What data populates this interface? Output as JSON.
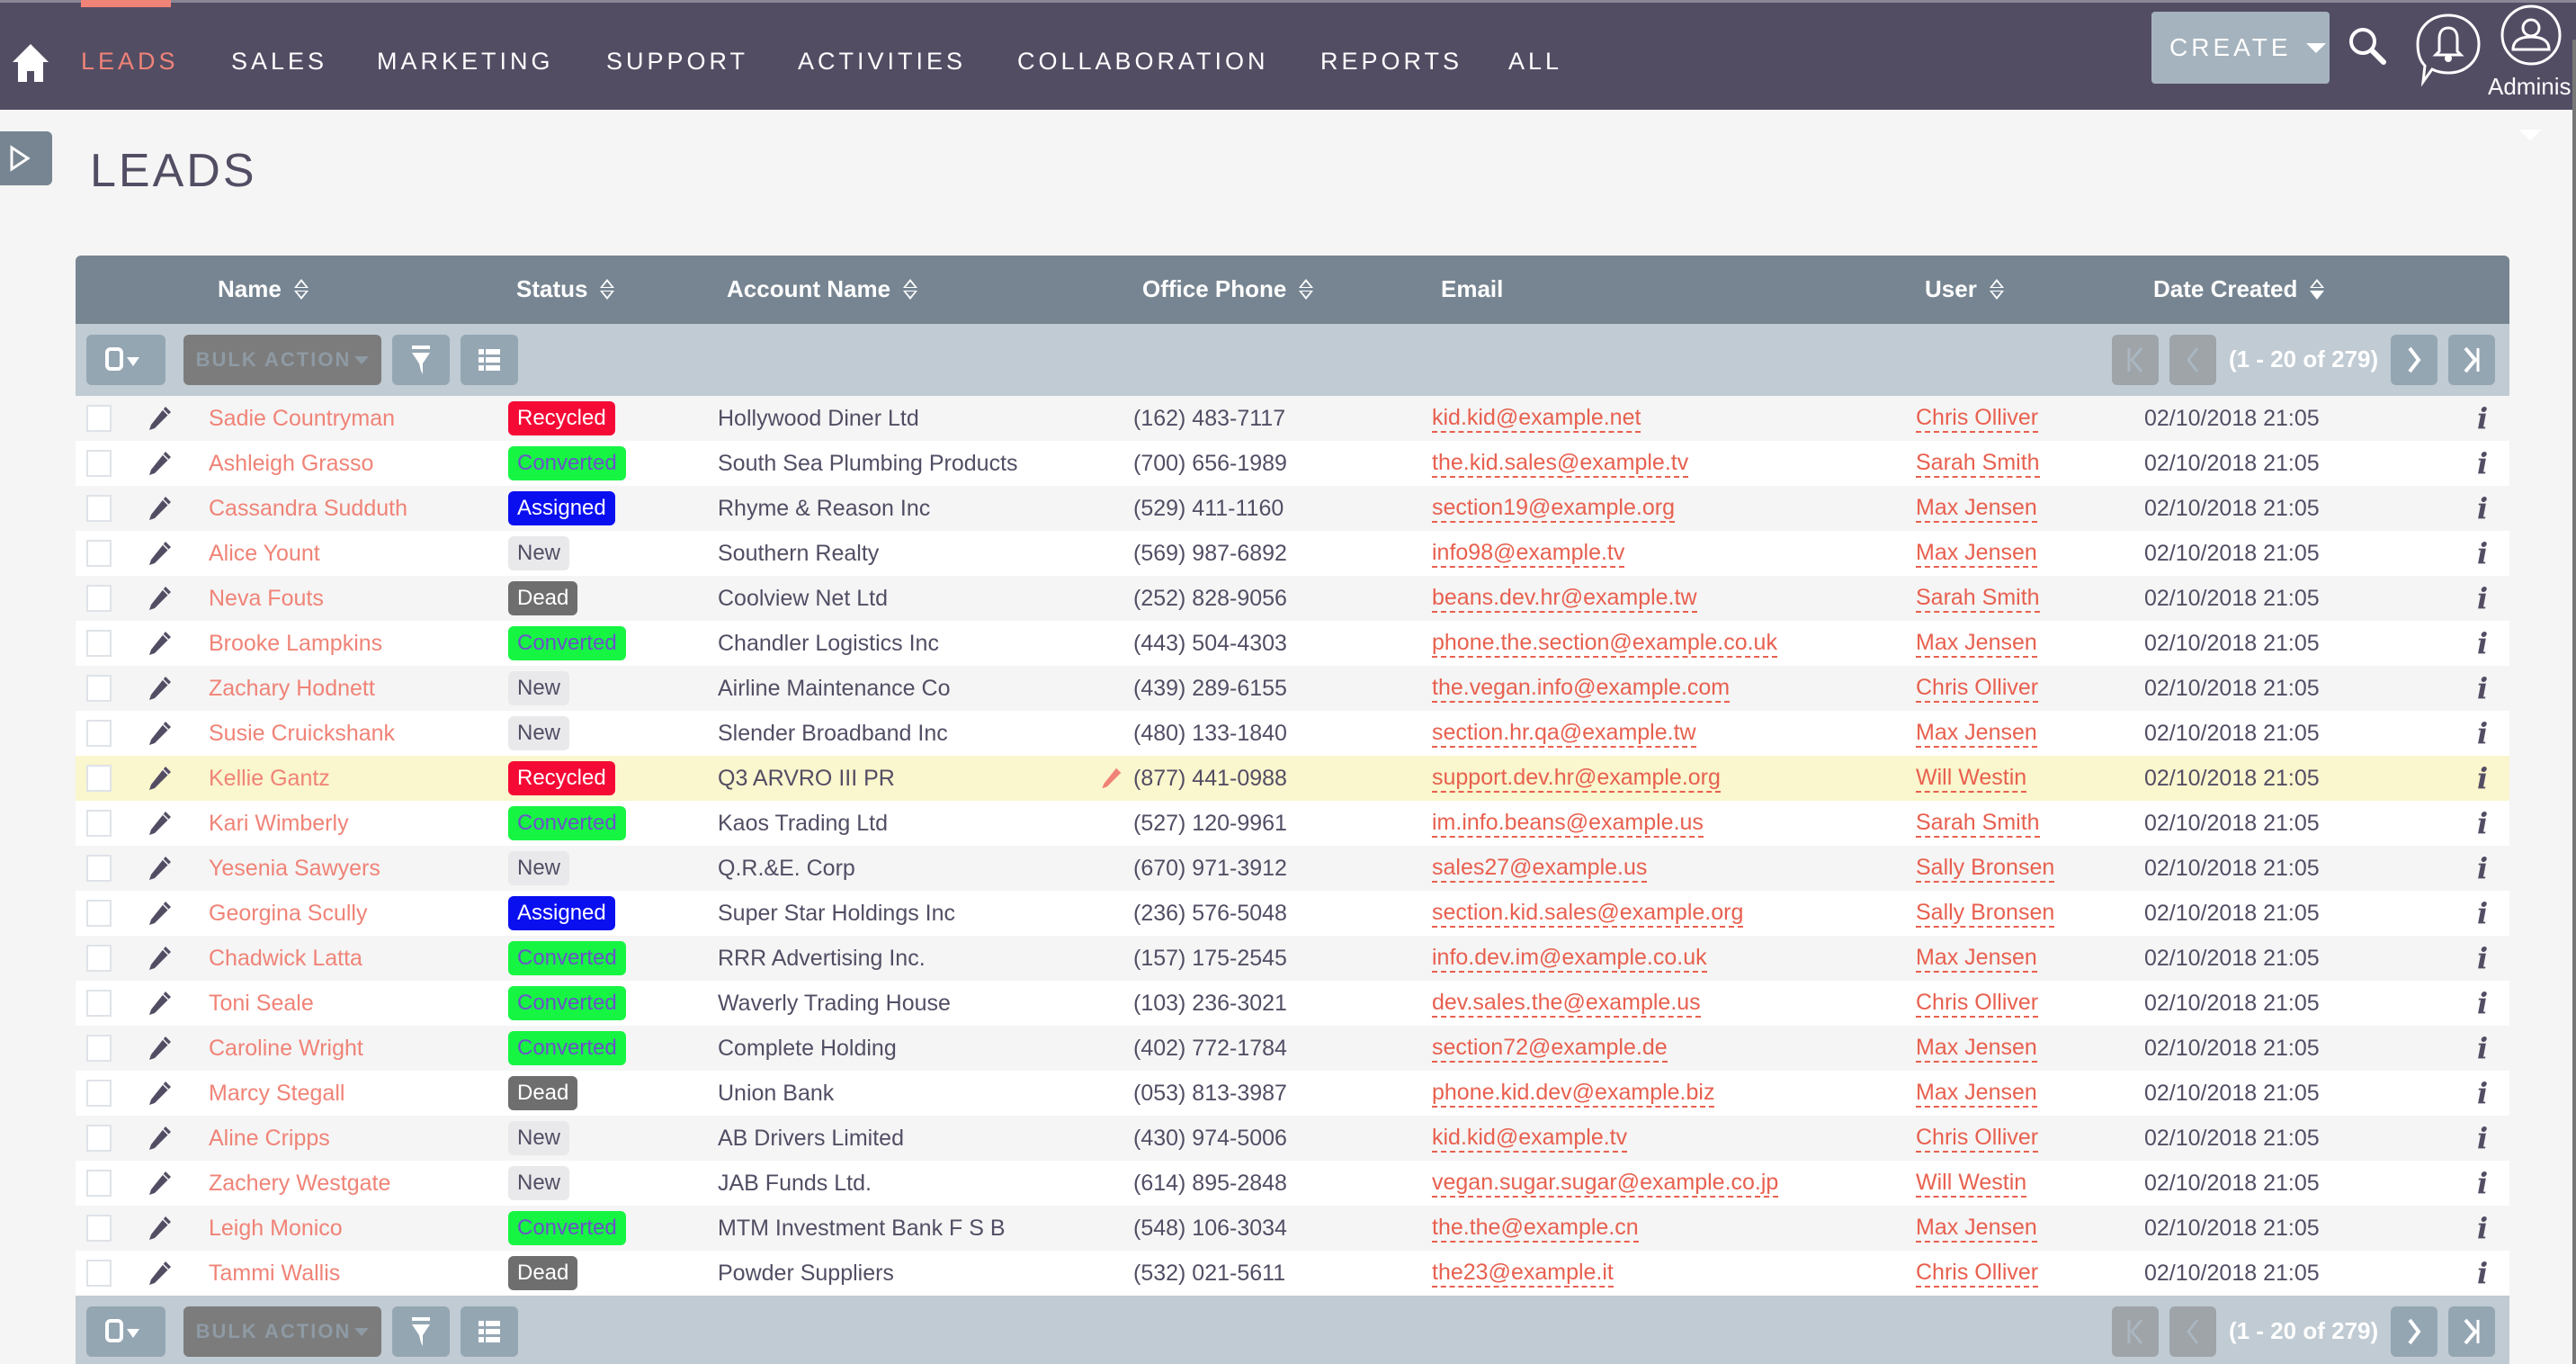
{
  "nav": {
    "home_icon": "home-icon",
    "tabs": [
      {
        "label": "LEADS",
        "active": true
      },
      {
        "label": "SALES"
      },
      {
        "label": "MARKETING"
      },
      {
        "label": "SUPPORT"
      },
      {
        "label": "ACTIVITIES"
      },
      {
        "label": "COLLABORATION"
      },
      {
        "label": "REPORTS"
      },
      {
        "label": "ALL"
      }
    ],
    "create_label": "CREATE",
    "search_icon": "search-icon",
    "notifications_icon": "bell-icon",
    "user_icon": "user-icon",
    "user_label": "Adminis"
  },
  "page": {
    "title": "LEADS"
  },
  "colors": {
    "nav_bg": "#534d64",
    "accent": "#f08377",
    "status_recycled": "#f50a36",
    "status_converted": "#17f543",
    "status_assigned": "#0a0ff0",
    "status_new": "#e9e9eb",
    "status_dead": "#6e6e6e"
  },
  "table": {
    "columns": [
      {
        "label": "Name",
        "sortable": true
      },
      {
        "label": "Status",
        "sortable": true
      },
      {
        "label": "Account Name",
        "sortable": true
      },
      {
        "label": "Office Phone",
        "sortable": true
      },
      {
        "label": "Email",
        "sortable": false
      },
      {
        "label": "User",
        "sortable": true
      },
      {
        "label": "Date Created",
        "sortable": true,
        "sorted": "desc"
      }
    ],
    "toolbar": {
      "bulk_action_label": "BULK ACTION",
      "pagination_text": "(1 - 20 of 279)"
    },
    "rows": [
      {
        "name": "Sadie Countryman",
        "status": "Recycled",
        "account": "Hollywood Diner Ltd",
        "phone": "(162) 483-7117",
        "email": "kid.kid@example.net",
        "user": "Chris Olliver",
        "date": "02/10/2018 21:05"
      },
      {
        "name": "Ashleigh Grasso",
        "status": "Converted",
        "account": "South Sea Plumbing Products",
        "phone": "(700) 656-1989",
        "email": "the.kid.sales@example.tv",
        "user": "Sarah Smith",
        "date": "02/10/2018 21:05"
      },
      {
        "name": "Cassandra Sudduth",
        "status": "Assigned",
        "account": "Rhyme & Reason Inc",
        "phone": "(529) 411-1160",
        "email": "section19@example.org",
        "user": "Max Jensen",
        "date": "02/10/2018 21:05"
      },
      {
        "name": "Alice Yount",
        "status": "New",
        "account": "Southern Realty",
        "phone": "(569) 987-6892",
        "email": "info98@example.tv",
        "user": "Max Jensen",
        "date": "02/10/2018 21:05"
      },
      {
        "name": "Neva Fouts",
        "status": "Dead",
        "account": "Coolview Net Ltd",
        "phone": "(252) 828-9056",
        "email": "beans.dev.hr@example.tw",
        "user": "Sarah Smith",
        "date": "02/10/2018 21:05"
      },
      {
        "name": "Brooke Lampkins",
        "status": "Converted",
        "account": "Chandler Logistics Inc",
        "phone": "(443) 504-4303",
        "email": "phone.the.section@example.co.uk",
        "user": "Max Jensen",
        "date": "02/10/2018 21:05"
      },
      {
        "name": "Zachary Hodnett",
        "status": "New",
        "account": "Airline Maintenance Co",
        "phone": "(439) 289-6155",
        "email": "the.vegan.info@example.com",
        "user": "Chris Olliver",
        "date": "02/10/2018 21:05"
      },
      {
        "name": "Susie Cruickshank",
        "status": "New",
        "account": "Slender Broadband Inc",
        "phone": "(480) 133-1840",
        "email": "section.hr.qa@example.tw",
        "user": "Max Jensen",
        "date": "02/10/2018 21:05"
      },
      {
        "name": "Kellie Gantz",
        "status": "Recycled",
        "account": "Q3 ARVRO III PR",
        "phone": "(877) 441-0988",
        "email": "support.dev.hr@example.org",
        "user": "Will Westin",
        "date": "02/10/2018 21:05",
        "highlighted": true
      },
      {
        "name": "Kari Wimberly",
        "status": "Converted",
        "account": "Kaos Trading Ltd",
        "phone": "(527) 120-9961",
        "email": "im.info.beans@example.us",
        "user": "Sarah Smith",
        "date": "02/10/2018 21:05"
      },
      {
        "name": "Yesenia Sawyers",
        "status": "New",
        "account": "Q.R.&E. Corp",
        "phone": "(670) 971-3912",
        "email": "sales27@example.us",
        "user": "Sally Bronsen",
        "date": "02/10/2018 21:05"
      },
      {
        "name": "Georgina Scully",
        "status": "Assigned",
        "account": "Super Star Holdings Inc",
        "phone": "(236) 576-5048",
        "email": "section.kid.sales@example.org",
        "user": "Sally Bronsen",
        "date": "02/10/2018 21:05"
      },
      {
        "name": "Chadwick Latta",
        "status": "Converted",
        "account": "RRR Advertising Inc.",
        "phone": "(157) 175-2545",
        "email": "info.dev.im@example.co.uk",
        "user": "Max Jensen",
        "date": "02/10/2018 21:05"
      },
      {
        "name": "Toni Seale",
        "status": "Converted",
        "account": "Waverly Trading House",
        "phone": "(103) 236-3021",
        "email": "dev.sales.the@example.us",
        "user": "Chris Olliver",
        "date": "02/10/2018 21:05"
      },
      {
        "name": "Caroline Wright",
        "status": "Converted",
        "account": "Complete Holding",
        "phone": "(402) 772-1784",
        "email": "section72@example.de",
        "user": "Max Jensen",
        "date": "02/10/2018 21:05"
      },
      {
        "name": "Marcy Stegall",
        "status": "Dead",
        "account": "Union Bank",
        "phone": "(053) 813-3987",
        "email": "phone.kid.dev@example.biz",
        "user": "Max Jensen",
        "date": "02/10/2018 21:05"
      },
      {
        "name": "Aline Cripps",
        "status": "New",
        "account": "AB Drivers Limited",
        "phone": "(430) 974-5006",
        "email": "kid.kid@example.tv",
        "user": "Chris Olliver",
        "date": "02/10/2018 21:05"
      },
      {
        "name": "Zachery Westgate",
        "status": "New",
        "account": "JAB Funds Ltd.",
        "phone": "(614) 895-2848",
        "email": "vegan.sugar.sugar@example.co.jp",
        "user": "Will Westin",
        "date": "02/10/2018 21:05"
      },
      {
        "name": "Leigh Monico",
        "status": "Converted",
        "account": "MTM Investment Bank F S B",
        "phone": "(548) 106-3034",
        "email": "the.the@example.cn",
        "user": "Max Jensen",
        "date": "02/10/2018 21:05"
      },
      {
        "name": "Tammi Wallis",
        "status": "Dead",
        "account": "Powder Suppliers",
        "phone": "(532) 021-5611",
        "email": "the23@example.it",
        "user": "Chris Olliver",
        "date": "02/10/2018 21:05"
      }
    ]
  }
}
